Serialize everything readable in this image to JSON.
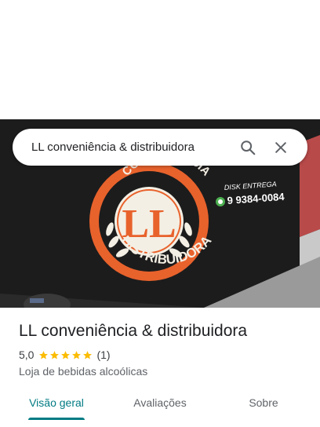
{
  "search": {
    "query": "LL conveniência & distribuidora",
    "search_icon": "search-icon",
    "close_icon": "close-icon"
  },
  "photo": {
    "logo_initials": "LL",
    "logo_top_text": "CONVENIÊNCIA",
    "logo_bottom_text": "DISTRIBUIDORA",
    "disk_entrega": "DISK ENTREGA",
    "phone": "9 9384-0084",
    "whatsapp_icon": "whatsapp-icon"
  },
  "place": {
    "name": "LL conveniência & distribuidora",
    "rating": "5,0",
    "stars": 5,
    "review_count": "(1)",
    "category": "Loja de bebidas alcoólicas"
  },
  "tabs": [
    {
      "label": "Visão geral",
      "active": true
    },
    {
      "label": "Avaliações",
      "active": false
    },
    {
      "label": "Sobre",
      "active": false
    }
  ],
  "colors": {
    "accent": "#007b83",
    "star": "#fbbc04",
    "logo_orange": "#e8622c"
  }
}
